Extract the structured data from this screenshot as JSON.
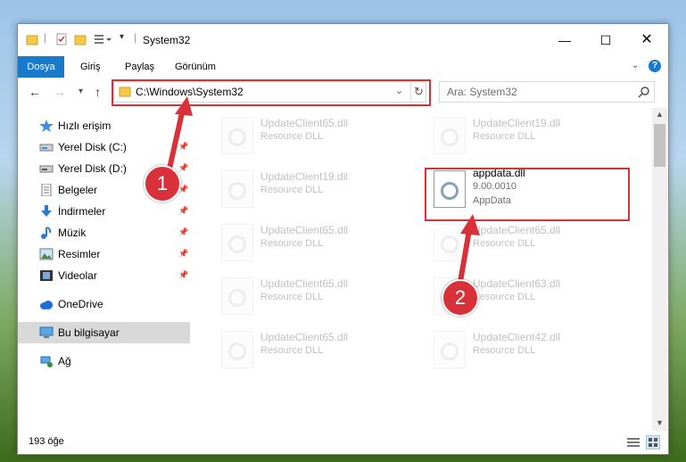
{
  "window": {
    "title": "System32"
  },
  "ribbon": {
    "tabs": [
      "Dosya",
      "Giriş",
      "Paylaş",
      "Görünüm"
    ]
  },
  "address": {
    "path": "C:\\Windows\\System32"
  },
  "search": {
    "placeholder": "Ara: System32"
  },
  "sidebar": {
    "items": [
      {
        "label": "Hızlı erişim",
        "icon": "star-icon"
      },
      {
        "label": "Yerel Disk (C:)",
        "icon": "drive-icon"
      },
      {
        "label": "Yerel Disk (D:)",
        "icon": "drive-icon"
      },
      {
        "label": "Belgeler",
        "icon": "documents-icon"
      },
      {
        "label": "İndirmeler",
        "icon": "download-icon"
      },
      {
        "label": "Müzik",
        "icon": "music-icon"
      },
      {
        "label": "Resimler",
        "icon": "pictures-icon"
      },
      {
        "label": "Videolar",
        "icon": "videos-icon"
      },
      {
        "label": "OneDrive",
        "icon": "cloud-icon"
      },
      {
        "label": "Bu bilgisayar",
        "icon": "computer-icon"
      },
      {
        "label": "Ağ",
        "icon": "network-icon"
      }
    ]
  },
  "files": [
    {
      "name": "UpdateClient65.dll",
      "type": "Resource DLL"
    },
    {
      "name": "UpdateClient19.dll",
      "type": "Resource DLL"
    },
    {
      "name": "UpdateClient19.dll",
      "type": "Resource DLL"
    },
    {
      "name": "appdata.dll",
      "version": "9.00.0010",
      "type": "AppData"
    },
    {
      "name": "UpdateClient65.dll",
      "type": "Resource DLL"
    },
    {
      "name": "UpdateClient65.dll",
      "type": "Resource DLL"
    },
    {
      "name": "UpdateClient65.dll",
      "type": "Resource DLL"
    },
    {
      "name": "UpdateClient63.dll",
      "type": "Resource DLL"
    },
    {
      "name": "UpdateClient65.dll",
      "type": "Resource DLL"
    },
    {
      "name": "UpdateClient42.dll",
      "type": "Resource DLL"
    }
  ],
  "status": {
    "count": "193 öğe"
  },
  "annotations": {
    "step1": "1",
    "step2": "2"
  },
  "colors": {
    "accent": "#1979ca",
    "highlight": "#d9313a"
  }
}
